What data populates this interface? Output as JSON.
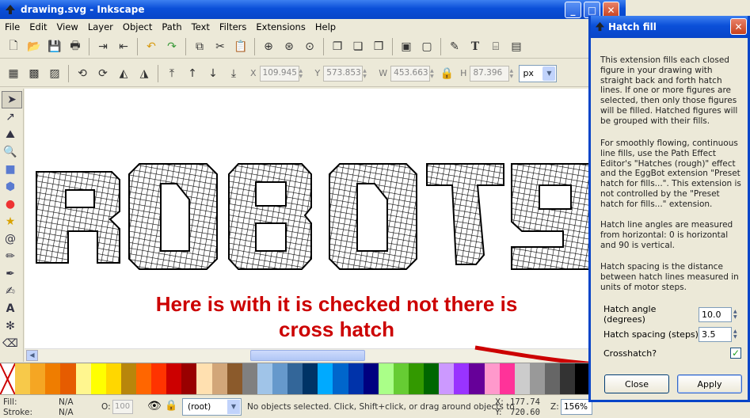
{
  "window": {
    "title": "drawing.svg - Inkscape"
  },
  "menu": [
    "File",
    "Edit",
    "View",
    "Layer",
    "Object",
    "Path",
    "Text",
    "Filters",
    "Extensions",
    "Help"
  ],
  "coords": {
    "x_label": "X",
    "x": "109.945",
    "y_label": "Y",
    "y": "573.853",
    "w_label": "W",
    "w": "453.663",
    "h_label": "H",
    "h": "87.396",
    "unit": "px"
  },
  "canvas": {
    "art_text": "ROBOTS"
  },
  "annotation": {
    "line1": "Here is with it is checked not there is",
    "line2": "cross hatch"
  },
  "palette": [
    "#ffffff",
    "#f7c94a",
    "#f5a623",
    "#ef7d00",
    "#e65c00",
    "#fff68f",
    "#ffff00",
    "#ffd700",
    "#b8860b",
    "#ff6600",
    "#ff3300",
    "#cc0000",
    "#990000",
    "#ffe0b0",
    "#d2a679",
    "#8b5a2b",
    "#808080",
    "#a0c4e8",
    "#6699cc",
    "#336699",
    "#003366",
    "#00aaff",
    "#0066cc",
    "#0033aa",
    "#000080",
    "#aaff88",
    "#66cc33",
    "#339900",
    "#006600",
    "#cc99ff",
    "#9933ff",
    "#660099",
    "#ff99cc",
    "#ff3399",
    "#cccccc",
    "#999999",
    "#666666",
    "#333333",
    "#000000"
  ],
  "status": {
    "fill_label": "Fill:",
    "fill_value": "N/A",
    "stroke_label": "Stroke:",
    "stroke_value": "N/A",
    "opacity_label": "O:",
    "opacity_value": "100",
    "layer": "(root)",
    "message": "No objects selected. Click, Shift+click, or drag around objects to",
    "x_label": "X:",
    "x": "177.74",
    "y_label": "Y:",
    "y": "720.60",
    "zoom_label": "Z:",
    "zoom": "156%"
  },
  "dialog": {
    "title": "Hatch fill",
    "para1": "This extension fills each closed figure in your drawing with straight back and forth hatch lines. If one or more figures are selected, then only those figures will be filled. Hatched figures will be grouped with their fills.",
    "para2": "For smoothly flowing, continuous line fills, use the Path Effect Editor's \"Hatches (rough)\" effect and the EggBot extension \"Preset hatch for fills...\". This extension is not controlled by the \"Preset hatch for fills...\" extension.",
    "para3": "Hatch line angles are measured from horizontal: 0 is horizontal and 90 is vertical.",
    "para4": "Hatch spacing is the distance between hatch lines measured in units of motor steps.",
    "angle_label": "Hatch angle (degrees)",
    "angle_value": "10.0",
    "spacing_label": "Hatch spacing (steps)",
    "spacing_value": "3.5",
    "crosshatch_label": "Crosshatch?",
    "close_label": "Close",
    "apply_label": "Apply"
  }
}
